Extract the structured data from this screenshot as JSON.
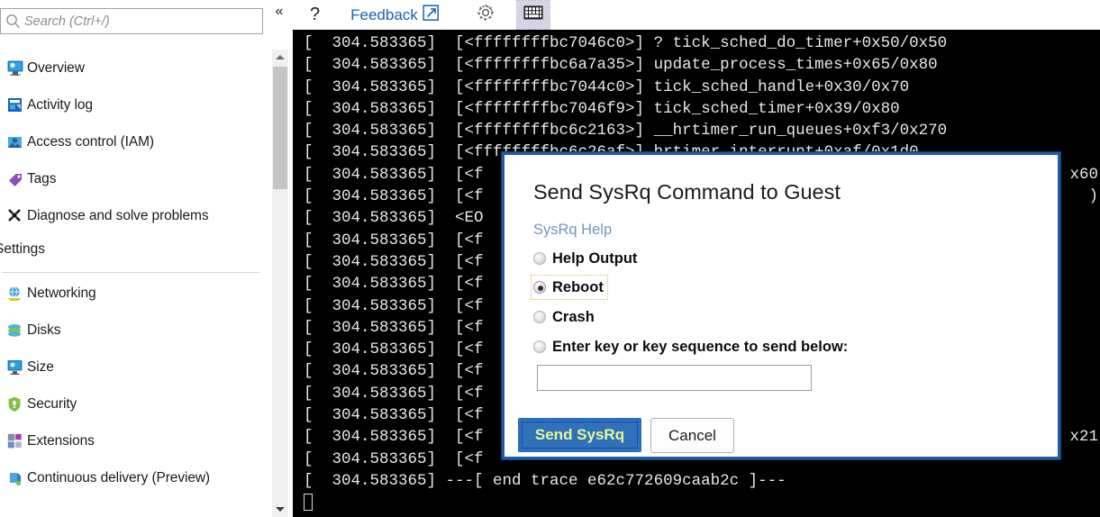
{
  "sidebar": {
    "search": {
      "placeholder": "Search (Ctrl+/)",
      "value": "",
      "icon": "search-icon"
    },
    "collapse_icon": "«",
    "items": [
      {
        "label": "Overview",
        "icon": "overview-icon"
      },
      {
        "label": "Activity log",
        "icon": "activity-log-icon"
      },
      {
        "label": "Access control (IAM)",
        "icon": "access-control-icon"
      },
      {
        "label": "Tags",
        "icon": "tag-icon"
      },
      {
        "label": "Diagnose and solve problems",
        "icon": "diagnose-icon"
      }
    ],
    "section_label": "Settings",
    "settings_items": [
      {
        "label": "Networking",
        "icon": "networking-icon"
      },
      {
        "label": "Disks",
        "icon": "disks-icon"
      },
      {
        "label": "Size",
        "icon": "size-icon"
      },
      {
        "label": "Security",
        "icon": "security-icon"
      },
      {
        "label": "Extensions",
        "icon": "extensions-icon"
      },
      {
        "label": "Continuous delivery (Preview)",
        "icon": "continuous-delivery-icon"
      }
    ]
  },
  "toolbar": {
    "help_label": "?",
    "feedback_label": "Feedback",
    "feedback_icon": "external-link-icon",
    "settings_icon": "gear-icon",
    "keyboard_icon": "keyboard-icon"
  },
  "terminal": {
    "lines": [
      "[  304.583365]  [<ffffffffbc7046c0>] ? tick_sched_do_timer+0x50/0x50",
      "[  304.583365]  [<ffffffffbc6a7a35>] update_process_times+0x65/0x80",
      "[  304.583365]  [<ffffffffbc7044c0>] tick_sched_handle+0x30/0x70",
      "[  304.583365]  [<ffffffffbc7046f9>] tick_sched_timer+0x39/0x80",
      "[  304.583365]  [<ffffffffbc6c2163>] __hrtimer_run_queues+0xf3/0x270",
      "[  304.583365]  [<ffffffffbc6c26af>] hrtimer_interrupt+0xaf/0x1d0",
      "[  304.583365]  [<f",
      "[  304.583365]  [<f",
      "[  304.583365]  <EO",
      "[  304.583365]  [<f",
      "[  304.583365]  [<f",
      "[  304.583365]  [<f",
      "[  304.583365]  [<f",
      "[  304.583365]  [<f",
      "[  304.583365]  [<f",
      "[  304.583365]  [<f",
      "[  304.583365]  [<f",
      "[  304.583365]  [<f",
      "[  304.583365]  [<f",
      "[  304.583365]  [<f",
      "[  304.583365] ---[ end trace e62c772609caab2c ]---"
    ],
    "right_fragments": [
      {
        "text": "x60",
        "line": 6
      },
      {
        "text": ")",
        "line": 7
      },
      {
        "text": "x21",
        "line": 18
      }
    ],
    "cursor": "block-cursor"
  },
  "dialog": {
    "title": "Send SysRq Command to Guest",
    "help_link": "SysRq Help",
    "options": [
      {
        "label": "Help Output",
        "checked": false,
        "focused": false
      },
      {
        "label": "Reboot",
        "checked": true,
        "focused": true
      },
      {
        "label": "Crash",
        "checked": false,
        "focused": false
      },
      {
        "label": "Enter key or key sequence to send below:",
        "checked": false,
        "focused": false
      }
    ],
    "key_input": {
      "value": "",
      "placeholder": ""
    },
    "send_label": "Send SysRq",
    "cancel_label": "Cancel"
  },
  "colors": {
    "accent_blue": "#1464b4",
    "dialog_border": "#1c5ca8",
    "primary_button": "#2f72b8",
    "primary_button_text": "#e8f59a",
    "terminal_bg": "#000000",
    "terminal_fg": "#e8e8e8",
    "link": "#7295bd"
  }
}
